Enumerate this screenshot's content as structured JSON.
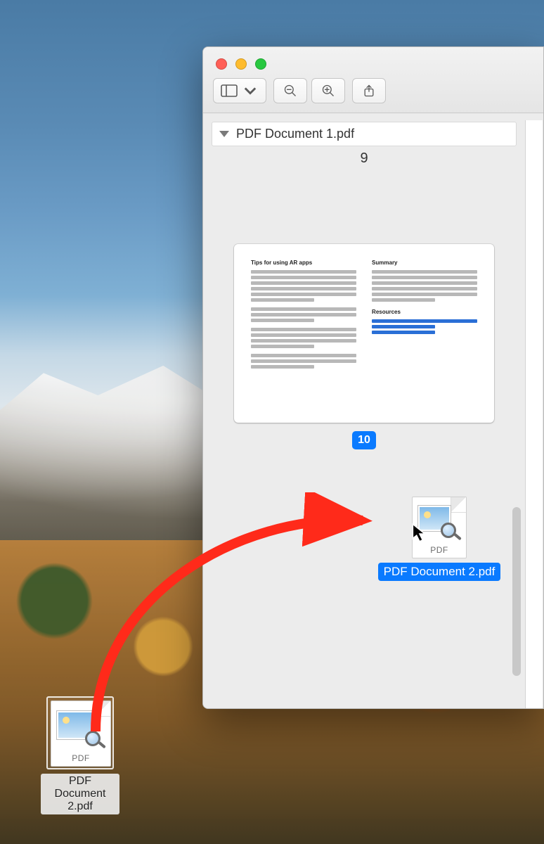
{
  "sidebar_doc_title": "PDF Document 1.pdf",
  "page_label_top": "9",
  "page_badge": "10",
  "thumb": {
    "left_heading": "Tips for using AR apps",
    "right_heading1": "Summary",
    "right_heading2": "Resources"
  },
  "pdf_tag": "PDF",
  "desk_file_name": "PDF Document 2.pdf",
  "drag_file_name": "PDF Document 2.pdf",
  "icons": {
    "sidebar_toggle": "sidebar-toggle-icon",
    "zoom_out": "zoom-out-icon",
    "zoom_in": "zoom-in-icon",
    "share": "share-icon"
  }
}
